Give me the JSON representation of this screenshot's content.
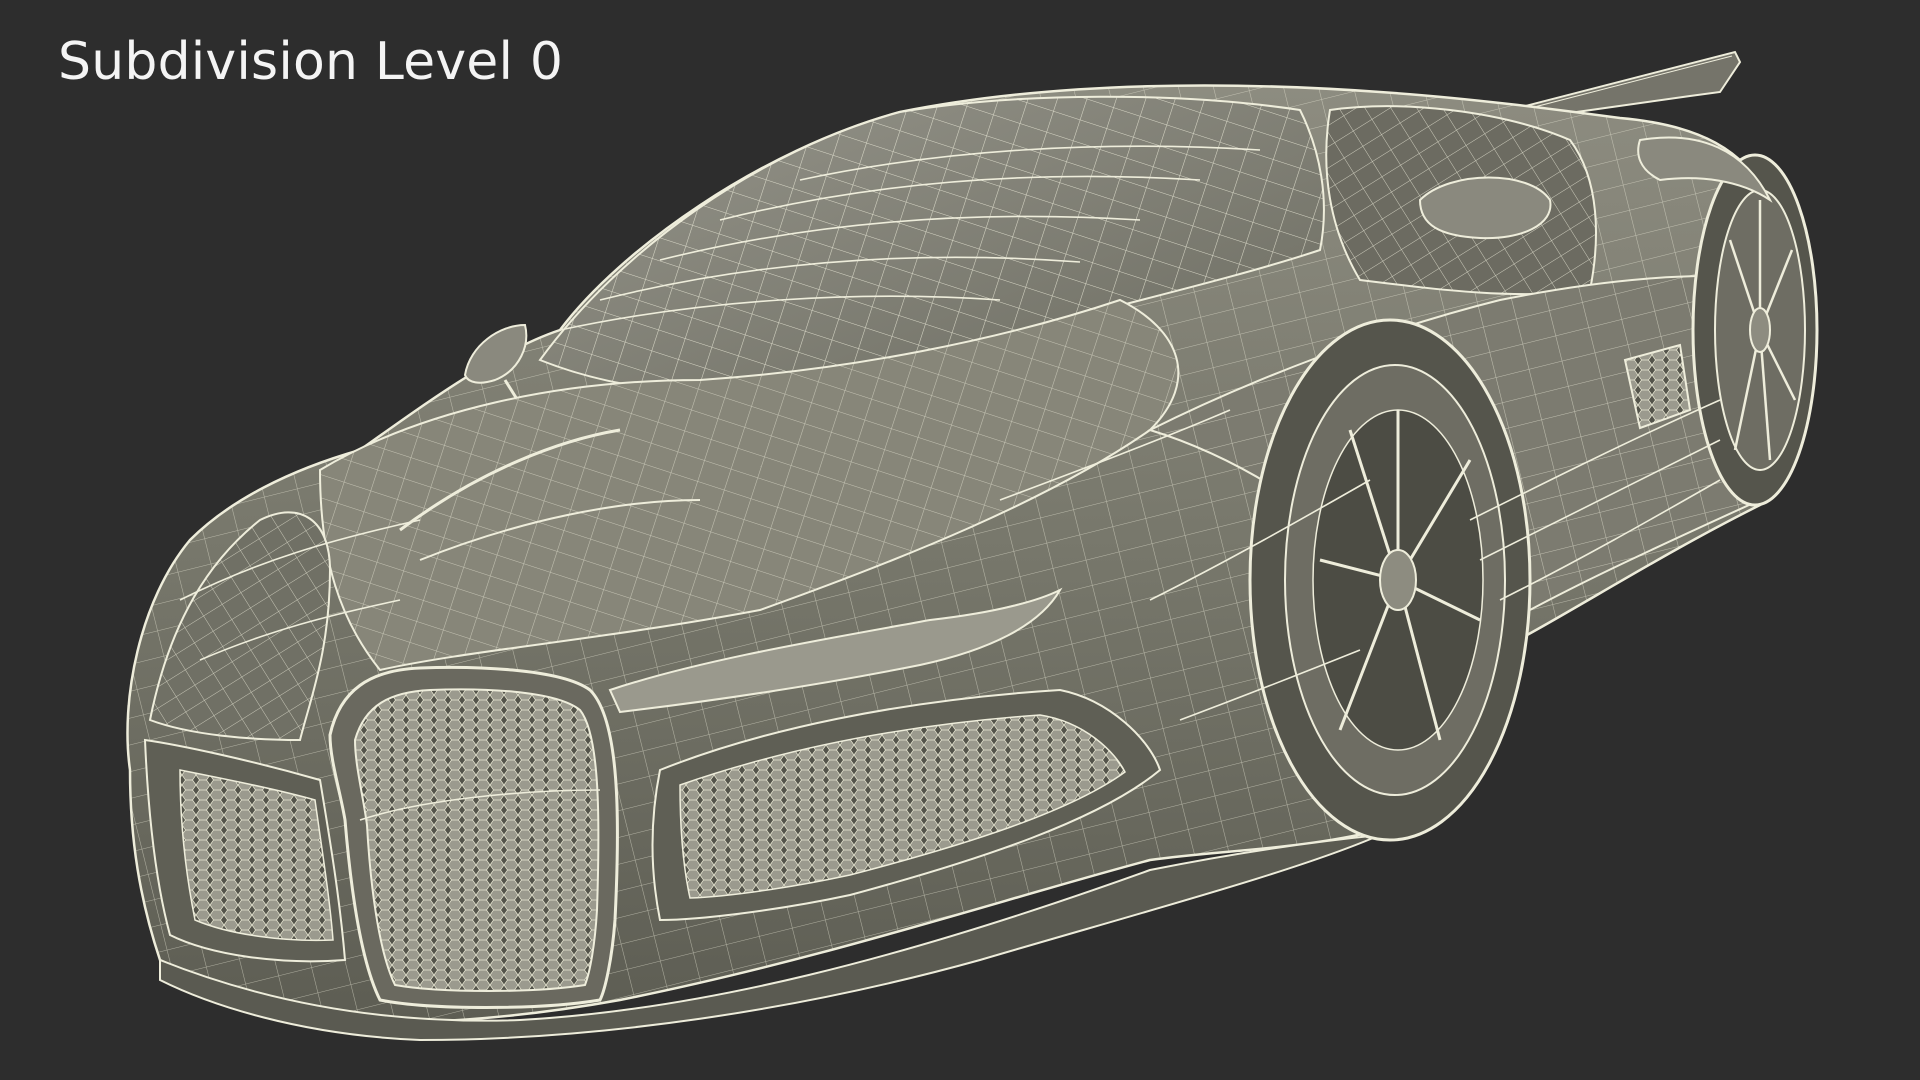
{
  "overlay": {
    "label": "Subdivision Level 0"
  },
  "render": {
    "subject": "sports-car-wireframe",
    "background_color": "#2d2d2d",
    "surface_color": "#7d7d6f",
    "wire_color": "#f1f0dc"
  }
}
